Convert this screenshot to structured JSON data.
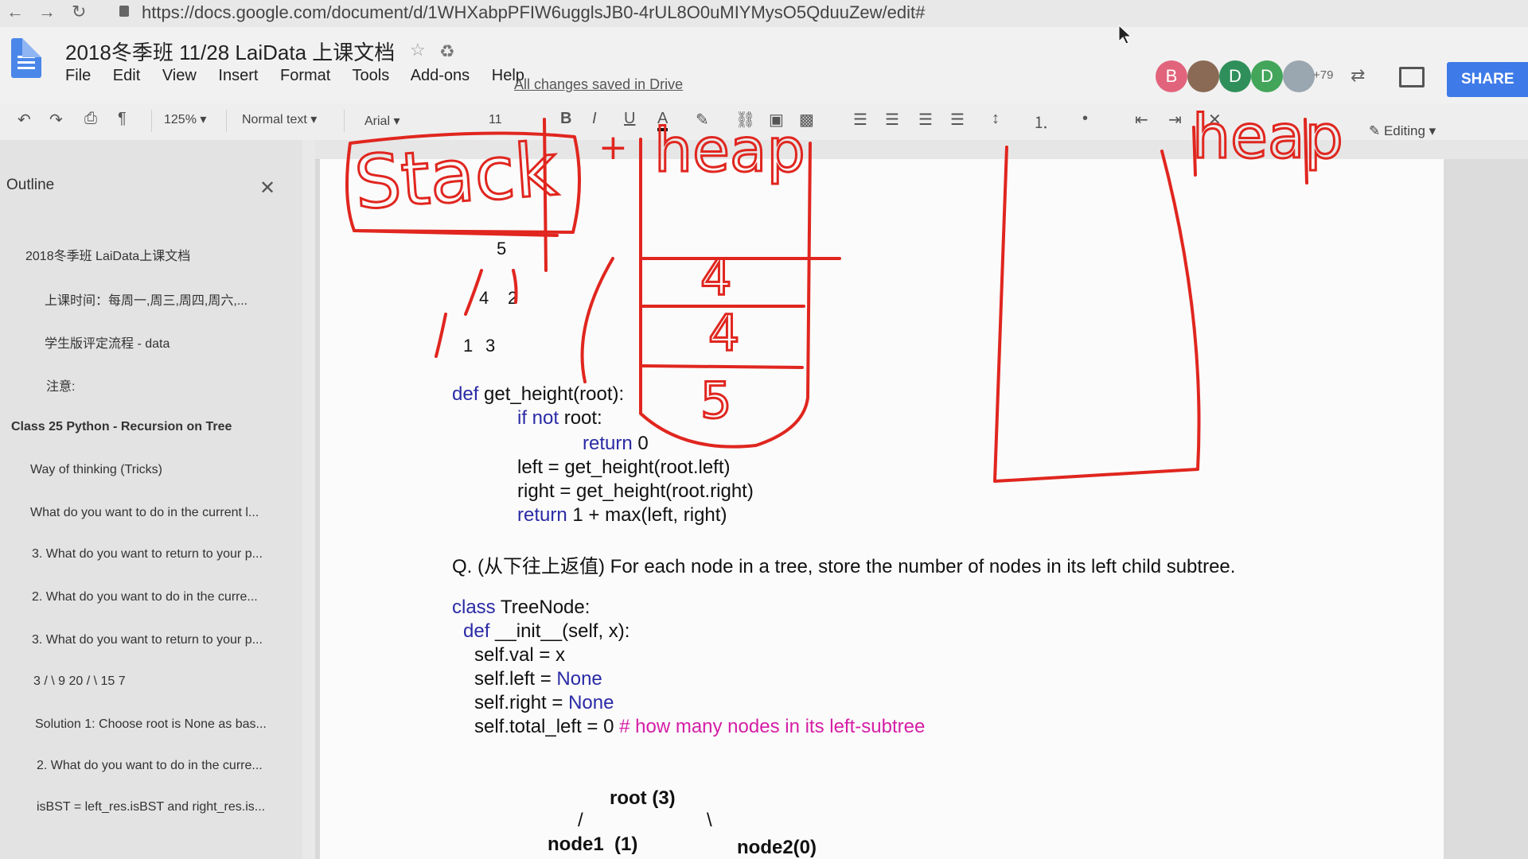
{
  "browser": {
    "url": "https://docs.google.com/document/d/1WHXabpPFIW6ugglsJB0-4rUL8O0uMIYMysO5QduuZew/edit#"
  },
  "header": {
    "title": "2018冬季班 11/28 LaiData 上课文档",
    "menu": [
      "File",
      "Edit",
      "View",
      "Insert",
      "Format",
      "Tools",
      "Add-ons",
      "Help"
    ],
    "save_status": "All changes saved in Drive",
    "avatars": [
      {
        "letter": "B",
        "color": "#e2647c"
      },
      {
        "letter": "",
        "color": "#8a6a55"
      },
      {
        "letter": "D",
        "color": "#2f8f5a"
      },
      {
        "letter": "D",
        "color": "#43a55a"
      },
      {
        "letter": "",
        "color": "#9aa6b0"
      }
    ],
    "avatar_count": "+79",
    "share_label": "SHARE"
  },
  "toolbar": {
    "zoom": "125%",
    "style": "Normal text",
    "font": "Arial",
    "font_size": "11",
    "editing_mode": "Editing"
  },
  "outline": {
    "title": "Outline",
    "items": [
      "2018冬季班 LaiData上课文档",
      "上课时间：每周一,周三,周四,周六,...",
      "学生版评定流程 - data",
      "注意:",
      "Class 25 Python - Recursion on Tree",
      "Way of thinking (Tricks)",
      "What do you want to do in the current l...",
      "3. What do you want to return to your p...",
      "2. What do you want to do in the curre...",
      "3. What do you want to return to your p...",
      "3 / \\ 9 20 / \\ 15 7",
      "Solution 1: Choose root is None as bas...",
      "2. What do you want to do in the curre...",
      "isBST = left_res.isBST and right_res.is..."
    ]
  },
  "document": {
    "tree_nodes": [
      "5",
      "4",
      "2",
      "1",
      "3"
    ],
    "code1": {
      "l1_kw": "def",
      "l1": " get_height(root):",
      "l2_kw": "if not",
      "l2": " root:",
      "l3_kw": "return",
      "l3": " 0",
      "l4": "left = get_height(root.left)",
      "l5": "right = get_height(root.right)",
      "l6_kw": "return",
      "l6": " 1 + max(left, right)"
    },
    "question": "Q. (从下往上返值) For each node in a tree, store the number of nodes in its left child subtree.",
    "code2": {
      "l1_kw": "class",
      "l1": " TreeNode:",
      "l2_kw": "def",
      "l2": " __init__(self, x):",
      "l3": "self.val = x",
      "l4a": "self.left = ",
      "l4b": "None",
      "l5a": "self.right = ",
      "l5b": "None",
      "l6": "self.total_left = 0 ",
      "l6_comment": "# how many nodes in its left-subtree"
    },
    "diagram": {
      "root": "root (3)",
      "slash_left": "/",
      "slash_right": "\\",
      "node1": "node1  (1)",
      "node2": "node2(0)"
    }
  },
  "handwriting": {
    "stack": "Stack",
    "heap": "heap",
    "heap2": "heap",
    "stack_frames": [
      "4",
      "4",
      "5"
    ],
    "plus": "+"
  }
}
